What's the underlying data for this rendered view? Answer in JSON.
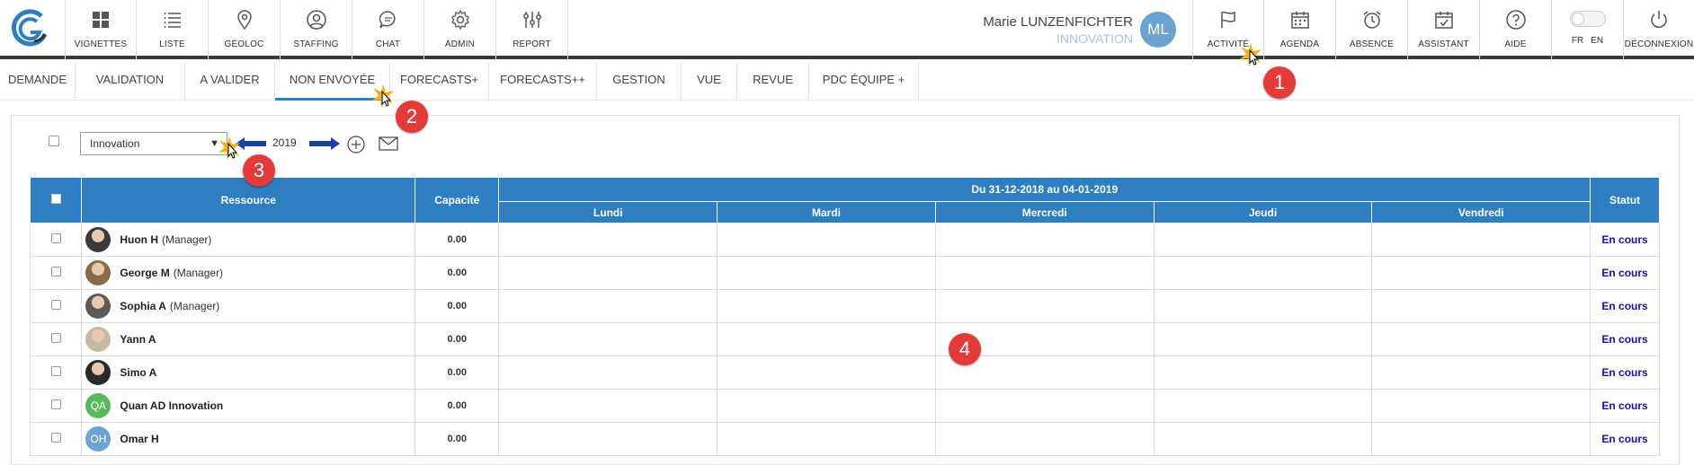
{
  "nav": {
    "items": [
      {
        "label": "VIGNETTES",
        "icon": "grid-icon"
      },
      {
        "label": "LISTE",
        "icon": "list-icon"
      },
      {
        "label": "GÉOLOC",
        "icon": "map-pin-icon"
      },
      {
        "label": "STAFFING",
        "icon": "user-circle-icon"
      },
      {
        "label": "CHAT",
        "icon": "chat-icon"
      },
      {
        "label": "ADMIN",
        "icon": "gear-icon"
      },
      {
        "label": "REPORT",
        "icon": "sliders-icon"
      }
    ],
    "right_items": [
      {
        "label": "ACTIVITÉ",
        "icon": "flag-icon"
      },
      {
        "label": "AGENDA",
        "icon": "calendar-icon"
      },
      {
        "label": "ABSENCE",
        "icon": "alarm-icon"
      },
      {
        "label": "ASSISTANT",
        "icon": "calendar-check-icon"
      },
      {
        "label": "AIDE",
        "icon": "help-icon"
      }
    ],
    "lang": {
      "fr": "FR",
      "en": "EN"
    },
    "logout": "DÉCONNEXION"
  },
  "user": {
    "name": "Marie LUNZENFICHTER",
    "org": "INNOVATION",
    "initials": "ML"
  },
  "tabs": [
    "DEMANDE",
    "VALIDATION",
    "A VALIDER",
    "NON ENVOYÉE",
    "FORECASTS+",
    "FORECASTS++",
    "GESTION",
    "VUE",
    "REVUE",
    "PDC ÉQUIPE +"
  ],
  "active_tab": "NON ENVOYÉE",
  "filter": {
    "team": "Innovation",
    "year": "2019"
  },
  "table": {
    "headers": {
      "resource": "Ressource",
      "capacity": "Capacité",
      "period": "Du 31-12-2018 au 04-01-2019",
      "status": "Statut",
      "days": [
        "Lundi",
        "Mardi",
        "Mercredi",
        "Jeudi",
        "Vendredi"
      ]
    },
    "rows": [
      {
        "name": "Huon H",
        "role": "(Manager)",
        "capacity": "0.00",
        "status": "En cours",
        "photo": true
      },
      {
        "name": "George M",
        "role": "(Manager)",
        "capacity": "0.00",
        "status": "En cours",
        "photo": true
      },
      {
        "name": "Sophia A",
        "role": "(Manager)",
        "capacity": "0.00",
        "status": "En cours",
        "photo": true
      },
      {
        "name": "Yann A",
        "role": "",
        "capacity": "0.00",
        "status": "En cours",
        "photo": true
      },
      {
        "name": "Simo A",
        "role": "",
        "capacity": "0.00",
        "status": "En cours",
        "photo": true
      },
      {
        "name": "Quan AD Innovation",
        "role": "",
        "capacity": "0.00",
        "status": "En cours",
        "initials": "QA",
        "color": "#5cb85c"
      },
      {
        "name": "Omar H",
        "role": "",
        "capacity": "0.00",
        "status": "En cours",
        "initials": "OH",
        "color": "#6ba4cf"
      }
    ]
  },
  "markers": [
    "1",
    "2",
    "3",
    "4"
  ],
  "colors": {
    "accent": "#2d7fc1",
    "marker": "#e33a3a",
    "status": "#1a0dab"
  }
}
